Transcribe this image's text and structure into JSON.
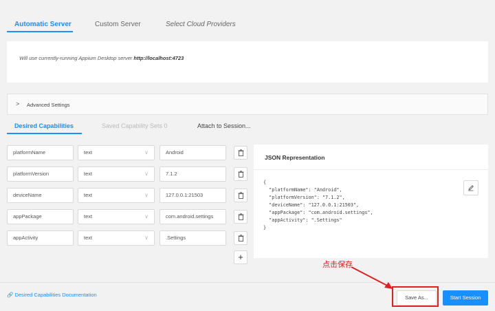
{
  "server_tabs": [
    "Automatic Server",
    "Custom Server",
    "Select Cloud Providers"
  ],
  "server_message": {
    "prefix": "Will use currently-running Appium Desktop server ",
    "url": "http://localhost:4723"
  },
  "advanced_settings_label": "Advanced Settings",
  "capability_tabs": [
    "Desired Capabilities",
    "Saved Capability Sets 0",
    "Attach to Session..."
  ],
  "capabilities": [
    {
      "name": "platformName",
      "type": "text",
      "value": "Android"
    },
    {
      "name": "platformVersion",
      "type": "text",
      "value": "7.1.2"
    },
    {
      "name": "deviceName",
      "type": "text",
      "value": "127.0.0.1:21503"
    },
    {
      "name": "appPackage",
      "type": "text",
      "value": "com.android.settings"
    },
    {
      "name": "appActivity",
      "type": "text",
      "value": ".Settings"
    }
  ],
  "add_button_label": "+",
  "json_panel": {
    "title": "JSON Representation",
    "code": "{\n  \"platformName\": \"Android\",\n  \"platformVersion\": \"7.1.2\",\n  \"deviceName\": \"127.0.0.1:21503\",\n  \"appPackage\": \"com.android.settings\",\n  \"appActivity\": \".Settings\"\n}"
  },
  "footer": {
    "docs_link": "Desired Capabilities Documentation",
    "save_as": "Save As...",
    "start_session": "Start Session"
  },
  "annotation": "点击保存",
  "colors": {
    "accent": "#1890ff",
    "annotation": "#e02020"
  },
  "icons": [
    "chevron-right-icon",
    "chevron-down-icon",
    "trash-icon",
    "edit-icon",
    "link-icon",
    "arrow-annotation"
  ]
}
